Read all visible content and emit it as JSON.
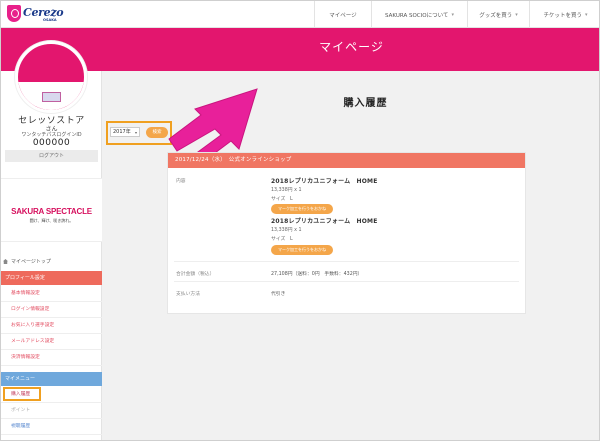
{
  "nav": {
    "logo_text": "Cerezo",
    "logo_sub": "OSAKA",
    "items": [
      {
        "label": "マイページ"
      },
      {
        "label": "SAKURA SOCIOについて"
      },
      {
        "label": "グッズを買う"
      },
      {
        "label": "チケットを買う"
      }
    ]
  },
  "banner": {
    "title": "マイページ"
  },
  "sidebar": {
    "card_text": "SAKURA　SOCIO",
    "user_name": "セレッソストア",
    "honorific": "さん",
    "login_label": "ワンタッチパスログインID",
    "login_id": "000000",
    "logout_label": "ログアウト",
    "spectacle_title": "SAKURA SPECTACLE",
    "spectacle_sub": "闘け、輝け、咲き誇れ。",
    "home_label": "マイページトップ",
    "profile_section": "プロフィール設定",
    "profile_links": [
      {
        "label": "基本情報設定"
      },
      {
        "label": "ログイン情報設定"
      },
      {
        "label": "お気に入り選手設定"
      },
      {
        "label": "メールアドレス設定"
      },
      {
        "label": "決済情報設定"
      }
    ],
    "my_section": "マイメニュー",
    "my_links": [
      {
        "label": "購入履歴"
      },
      {
        "label": "ポイント"
      },
      {
        "label": "視聴履歴"
      }
    ]
  },
  "main": {
    "page_title": "購入履歴",
    "year_value": "2017年",
    "search_label": "検索",
    "order": {
      "header": "2017/12/24（水）　公式オンラインショップ",
      "content_label": "内容",
      "items": [
        {
          "name": "2018レプリカユニフォーム　HOME",
          "price_qty": "13,338円 x 1",
          "size": "サイズ　L",
          "button": "マーク加工を行うをおかね"
        },
        {
          "name": "2018レプリカユニフォーム　HOME",
          "price_qty": "13,338円 x 1",
          "size": "サイズ　L",
          "button": "マーク加工を行うをおかね"
        }
      ],
      "total_label": "合計金額（税込）",
      "total_value": "27,108円（送料：0円　手数料：432円）",
      "payment_label": "支払い方法",
      "payment_value": "代引き"
    }
  },
  "colors": {
    "brand_pink": "#e3166e",
    "header_coral": "#f07663",
    "button_orange": "#f4a64a",
    "highlight_orange": "#f0a020",
    "profile_head": "#ee6a5c",
    "my_head": "#6fa8dc"
  }
}
